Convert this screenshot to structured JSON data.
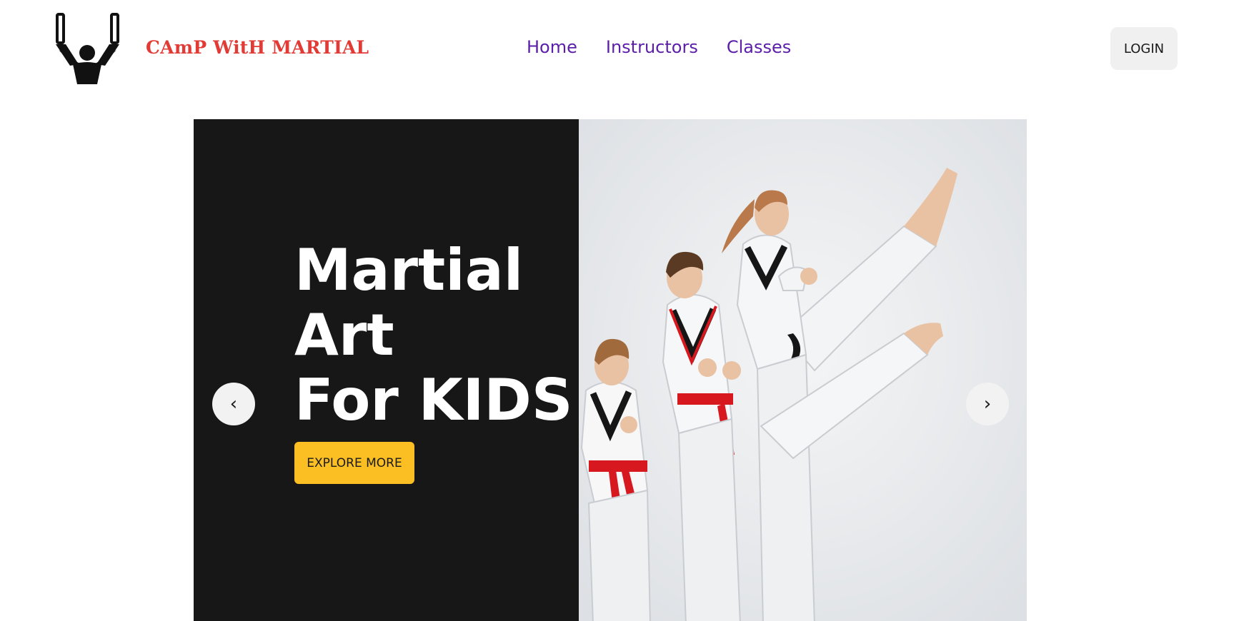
{
  "header": {
    "brand": "CAmP WitH MARTIAL",
    "logo_icon": "fighter-with-nunchaku-icon",
    "nav": [
      {
        "label": "Home"
      },
      {
        "label": "Instructors"
      },
      {
        "label": "Classes"
      }
    ],
    "login_label": "LOGIN"
  },
  "hero": {
    "title_lines": [
      "Martial",
      "Art",
      "For KIDS"
    ],
    "cta_label": "EXPLORE MORE",
    "prev_icon": "‹",
    "next_icon": "›",
    "image": "kids-martial-arts-kicking-photo"
  },
  "colors": {
    "brand": "#e23a35",
    "nav": "#5b1ea8",
    "hero_panel": "#171717",
    "cta": "#fbbf24",
    "belt": "#d7191f"
  }
}
